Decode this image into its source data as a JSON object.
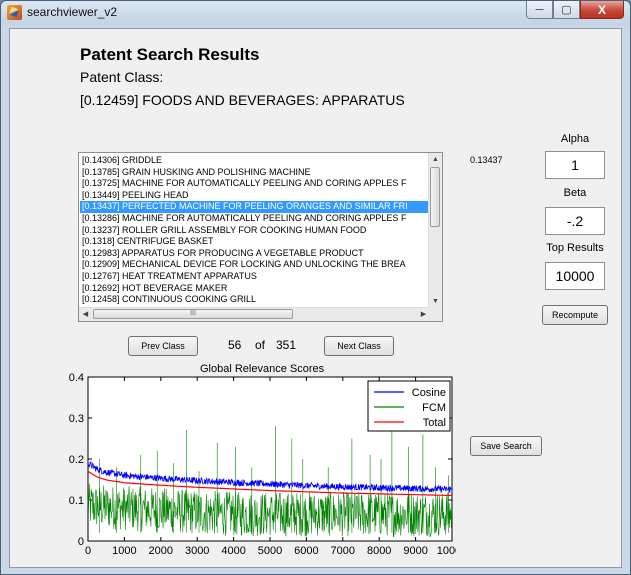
{
  "window": {
    "title": "searchviewer_v2",
    "controls": [
      "─",
      "▢",
      "X"
    ]
  },
  "header": {
    "title": "Patent Search Results",
    "class_label": "Patent Class:",
    "class_value": "[0.12459] FOODS AND BEVERAGES: APPARATUS"
  },
  "results": {
    "selected_index": 4,
    "selected_score": "0.13437",
    "items": [
      "[0.14306] GRIDDLE",
      "[0.13785] GRAIN HUSKING AND POLISHING MACHINE",
      "[0.13725] MACHINE FOR AUTOMATICALLY PEELING AND CORING APPLES F",
      "[0.13449] PEELING HEAD",
      "[0.13437] PERFECTED MACHINE FOR PEELING ORANGES AND SIMILAR FRI",
      "[0.13286] MACHINE FOR AUTOMATICALLY PEELING AND CORING APPLES F",
      "[0.13237] ROLLER GRILL ASSEMBLY FOR COOKING HUMAN FOOD",
      "[0.1318] CENTRIFUGE BASKET",
      "[0.12983] APPARATUS FOR PRODUCING A VEGETABLE PRODUCT",
      "[0.12909] MECHANICAL DEVICE FOR LOCKING AND UNLOCKING THE BREA",
      "[0.12767] HEAT TREATMENT APPARATUS",
      "[0.12692] HOT BEVERAGE MAKER",
      "[0.12458] CONTINUOUS COOKING GRILL"
    ],
    "scroll_grip": "III"
  },
  "params": {
    "alpha_label": "Alpha",
    "alpha_value": "1",
    "beta_label": "Beta",
    "beta_value": "-.2",
    "top_label": "Top Results",
    "top_value": "10000",
    "recompute_label": "Recompute",
    "save_label": "Save Search"
  },
  "pager": {
    "prev_label": "Prev Class",
    "current": "56",
    "of_label": "of",
    "total": "351",
    "next_label": "Next Class"
  },
  "colors": {
    "cosine": "#0000ff",
    "fcm": "#008000",
    "total": "#ff0000",
    "selection": "#3399ff"
  },
  "chart_data": {
    "type": "line",
    "title": "Global Relevance Scores",
    "xlabel": "",
    "ylabel": "",
    "xlim": [
      0,
      10000
    ],
    "ylim": [
      0,
      0.4
    ],
    "xticks": [
      0,
      1000,
      2000,
      3000,
      4000,
      5000,
      6000,
      7000,
      8000,
      9000,
      10000
    ],
    "yticks": [
      "0",
      "0.1",
      "0.2",
      "0.3",
      "0.4"
    ],
    "legend_position": "top-right",
    "series": [
      {
        "name": "Cosine",
        "x": [
          0,
          250,
          500,
          1000,
          2000,
          3000,
          4000,
          5000,
          6000,
          7000,
          8000,
          9000,
          10000
        ],
        "values": [
          0.19,
          0.175,
          0.168,
          0.16,
          0.153,
          0.147,
          0.143,
          0.139,
          0.135,
          0.132,
          0.13,
          0.128,
          0.126
        ]
      },
      {
        "name": "FCM",
        "x": [
          0,
          2000,
          4000,
          6000,
          8000,
          10000
        ],
        "values": [
          0.08,
          0.07,
          0.06,
          0.06,
          0.06,
          0.06
        ],
        "spikes": [
          [
            320,
            0.2
          ],
          [
            780,
            0.18
          ],
          [
            1450,
            0.21
          ],
          [
            1900,
            0.22
          ],
          [
            2350,
            0.19
          ],
          [
            2700,
            0.27
          ],
          [
            3050,
            0.17
          ],
          [
            3550,
            0.24
          ],
          [
            4050,
            0.23
          ],
          [
            4500,
            0.18
          ],
          [
            5150,
            0.28
          ],
          [
            5600,
            0.25
          ],
          [
            5900,
            0.2
          ],
          [
            6600,
            0.18
          ],
          [
            7250,
            0.25
          ],
          [
            7750,
            0.21
          ],
          [
            8050,
            0.2
          ],
          [
            8350,
            0.29
          ],
          [
            8800,
            0.23
          ],
          [
            9200,
            0.26
          ],
          [
            9550,
            0.18
          ],
          [
            9900,
            0.16
          ]
        ]
      },
      {
        "name": "Total",
        "x": [
          0,
          250,
          500,
          1000,
          2000,
          3000,
          4000,
          5000,
          6000,
          7000,
          8000,
          9000,
          10000
        ],
        "values": [
          0.17,
          0.156,
          0.149,
          0.142,
          0.136,
          0.131,
          0.127,
          0.123,
          0.12,
          0.117,
          0.115,
          0.113,
          0.111
        ]
      }
    ]
  }
}
